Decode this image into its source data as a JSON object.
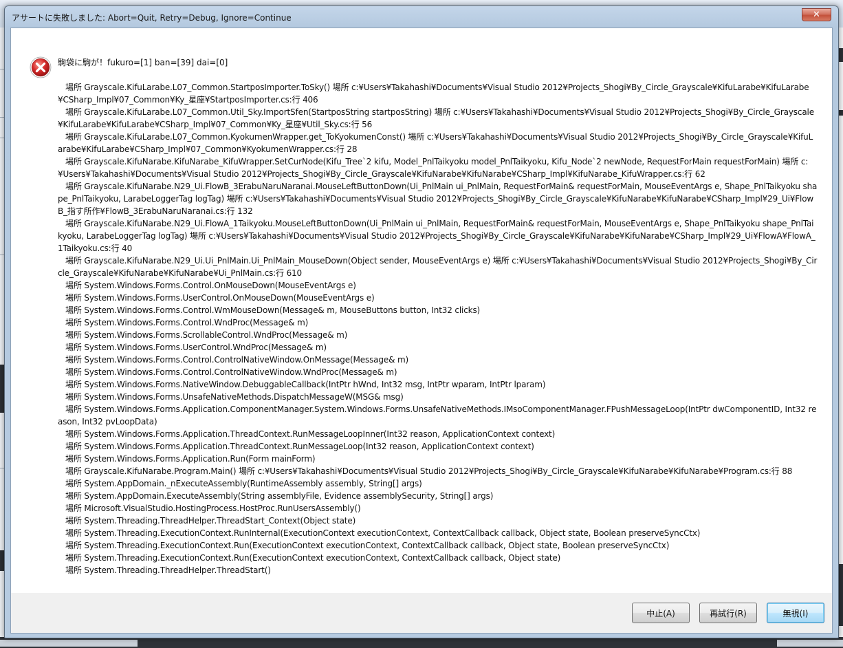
{
  "dialog": {
    "title": "アサートに失敗しました: Abort=Quit, Retry=Debug, Ignore=Continue",
    "close_glyph": "✕",
    "icon": "error-icon",
    "message": "駒袋に駒が！fukuro=[1] ban=[39] dai=[0]",
    "stack_lines": [
      "   場所 Grayscale.KifuLarabe.L07_Common.StartposImporter.ToSky() 場所 c:¥Users¥Takahashi¥Documents¥Visual Studio 2012¥Projects_Shogi¥By_Circle_Grayscale¥KifuLarabe¥KifuLarabe¥CSharp_Impl¥07_Common¥Ky_星座¥StartposImporter.cs:行 406",
      "   場所 Grayscale.KifuLarabe.L07_Common.Util_Sky.ImportSfen(StartposString startposString) 場所 c:¥Users¥Takahashi¥Documents¥Visual Studio 2012¥Projects_Shogi¥By_Circle_Grayscale¥KifuLarabe¥KifuLarabe¥CSharp_Impl¥07_Common¥Ky_星座¥Util_Sky.cs:行 56",
      "   場所 Grayscale.KifuLarabe.L07_Common.KyokumenWrapper.get_ToKyokumenConst() 場所 c:¥Users¥Takahashi¥Documents¥Visual Studio 2012¥Projects_Shogi¥By_Circle_Grayscale¥KifuLarabe¥KifuLarabe¥CSharp_Impl¥07_Common¥KyokumenWrapper.cs:行 28",
      "   場所 Grayscale.KifuNarabe.KifuNarabe_KifuWrapper.SetCurNode(Kifu_Tree`2 kifu, Model_PnlTaikyoku model_PnlTaikyoku, Kifu_Node`2 newNode, RequestForMain requestForMain) 場所 c:¥Users¥Takahashi¥Documents¥Visual Studio 2012¥Projects_Shogi¥By_Circle_Grayscale¥KifuNarabe¥KifuNarabe¥CSharp_Impl¥KifuNarabe_KifuWrapper.cs:行 62",
      "   場所 Grayscale.KifuNarabe.N29_Ui.FlowB_3ErabuNaruNaranai.MouseLeftButtonDown(Ui_PnlMain ui_PnlMain, RequestForMain& requestForMain, MouseEventArgs e, Shape_PnlTaikyoku shape_PnlTaikyoku, LarabeLoggerTag logTag) 場所 c:¥Users¥Takahashi¥Documents¥Visual Studio 2012¥Projects_Shogi¥By_Circle_Grayscale¥KifuNarabe¥KifuNarabe¥CSharp_Impl¥29_Ui¥FlowB_指す所作¥FlowB_3ErabuNaruNaranai.cs:行 132",
      "   場所 Grayscale.KifuNarabe.N29_Ui.FlowA_1Taikyoku.MouseLeftButtonDown(Ui_PnlMain ui_PnlMain, RequestForMain& requestForMain, MouseEventArgs e, Shape_PnlTaikyoku shape_PnlTaikyoku, LarabeLoggerTag logTag) 場所 c:¥Users¥Takahashi¥Documents¥Visual Studio 2012¥Projects_Shogi¥By_Circle_Grayscale¥KifuNarabe¥KifuNarabe¥CSharp_Impl¥29_Ui¥FlowA¥FlowA_1Taikyoku.cs:行 40",
      "   場所 Grayscale.KifuNarabe.N29_Ui.Ui_PnlMain.Ui_PnlMain_MouseDown(Object sender, MouseEventArgs e) 場所 c:¥Users¥Takahashi¥Documents¥Visual Studio 2012¥Projects_Shogi¥By_Circle_Grayscale¥KifuNarabe¥KifuNarabe¥Ui_PnlMain.cs:行 610",
      "   場所 System.Windows.Forms.Control.OnMouseDown(MouseEventArgs e)",
      "   場所 System.Windows.Forms.UserControl.OnMouseDown(MouseEventArgs e)",
      "   場所 System.Windows.Forms.Control.WmMouseDown(Message& m, MouseButtons button, Int32 clicks)",
      "   場所 System.Windows.Forms.Control.WndProc(Message& m)",
      "   場所 System.Windows.Forms.ScrollableControl.WndProc(Message& m)",
      "   場所 System.Windows.Forms.UserControl.WndProc(Message& m)",
      "   場所 System.Windows.Forms.Control.ControlNativeWindow.OnMessage(Message& m)",
      "   場所 System.Windows.Forms.Control.ControlNativeWindow.WndProc(Message& m)",
      "   場所 System.Windows.Forms.NativeWindow.DebuggableCallback(IntPtr hWnd, Int32 msg, IntPtr wparam, IntPtr lparam)",
      "   場所 System.Windows.Forms.UnsafeNativeMethods.DispatchMessageW(MSG& msg)",
      "   場所 System.Windows.Forms.Application.ComponentManager.System.Windows.Forms.UnsafeNativeMethods.IMsoComponentManager.FPushMessageLoop(IntPtr dwComponentID, Int32 reason, Int32 pvLoopData)",
      "   場所 System.Windows.Forms.Application.ThreadContext.RunMessageLoopInner(Int32 reason, ApplicationContext context)",
      "   場所 System.Windows.Forms.Application.ThreadContext.RunMessageLoop(Int32 reason, ApplicationContext context)",
      "   場所 System.Windows.Forms.Application.Run(Form mainForm)",
      "   場所 Grayscale.KifuNarabe.Program.Main() 場所 c:¥Users¥Takahashi¥Documents¥Visual Studio 2012¥Projects_Shogi¥By_Circle_Grayscale¥KifuNarabe¥KifuNarabe¥Program.cs:行 88",
      "   場所 System.AppDomain._nExecuteAssembly(RuntimeAssembly assembly, String[] args)",
      "   場所 System.AppDomain.ExecuteAssembly(String assemblyFile, Evidence assemblySecurity, String[] args)",
      "   場所 Microsoft.VisualStudio.HostingProcess.HostProc.RunUsersAssembly()",
      "   場所 System.Threading.ThreadHelper.ThreadStart_Context(Object state)",
      "   場所 System.Threading.ExecutionContext.RunInternal(ExecutionContext executionContext, ContextCallback callback, Object state, Boolean preserveSyncCtx)",
      "   場所 System.Threading.ExecutionContext.Run(ExecutionContext executionContext, ContextCallback callback, Object state, Boolean preserveSyncCtx)",
      "   場所 System.Threading.ExecutionContext.Run(ExecutionContext executionContext, ContextCallback callback, Object state)",
      "   場所 System.Threading.ThreadHelper.ThreadStart()"
    ],
    "buttons": {
      "abort": "中止(A)",
      "retry": "再試行(R)",
      "ignore": "無視(I)"
    }
  },
  "colors": {
    "error_red": "#d62b2b",
    "title_gradient_top": "#c4d6ea",
    "default_button_border": "#3c7fb1"
  }
}
